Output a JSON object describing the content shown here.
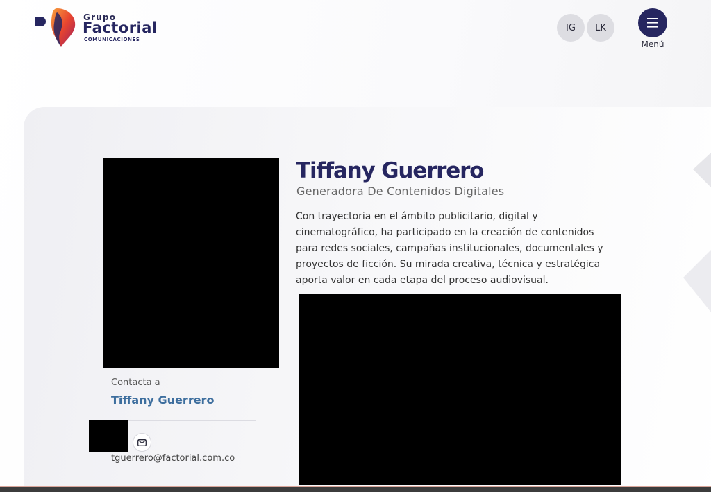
{
  "header": {
    "logo": {
      "small": "Grupo",
      "big": "Factorial",
      "tiny": "COMUNICACIONES",
      "colors": {
        "navy": "#262660",
        "orange": "#f07a2a",
        "magenta": "#c8265a"
      }
    },
    "social": [
      {
        "label": "IG"
      },
      {
        "label": "LK"
      }
    ],
    "menu": {
      "icon": "hamburger-icon",
      "label": "Menú",
      "color": "#262660"
    }
  },
  "profile": {
    "name": "Tiffany Guerrero",
    "role": "Generadora De Contenidos Digitales",
    "bio": "Con trayectoria en el ámbito publicitario, digital y cinematográfico, ha participado en la creación de contenidos para redes sociales, campañas institucionales, documentales y proyectos de ficción. Su mirada creativa, técnica y estratégica aporta valor en cada etapa del proceso audiovisual."
  },
  "contact": {
    "label": "Contacta a",
    "name": "Tiffany Guerrero",
    "email": "tguerrero@factorial.com.co",
    "mail_icon": "envelope-icon",
    "name_color": "#3d6e9e"
  }
}
